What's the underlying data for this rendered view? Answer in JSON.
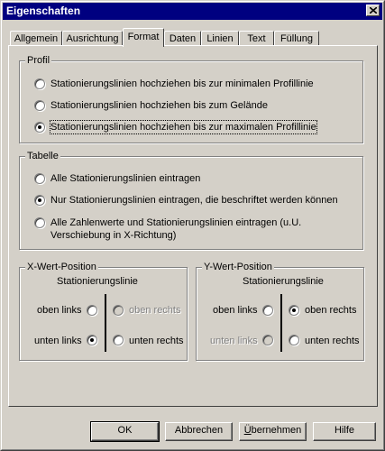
{
  "window": {
    "title": "Eigenschaften"
  },
  "tabs": [
    {
      "label": "Allgemein"
    },
    {
      "label": "Ausrichtung"
    },
    {
      "label": "Format"
    },
    {
      "label": "Daten"
    },
    {
      "label": "Linien"
    },
    {
      "label": "Text"
    },
    {
      "label": "Füllung"
    }
  ],
  "active_tab": "Format",
  "profil": {
    "label": "Profil",
    "options": [
      {
        "label": "Stationierungslinien hochziehen bis zur minimalen Profillinie",
        "checked": false
      },
      {
        "label": "Stationierungslinien hochziehen bis zum Gelände",
        "checked": false
      },
      {
        "label": "Stationierungslinien hochziehen bis zur maximalen Profillinie",
        "checked": true
      }
    ]
  },
  "tabelle": {
    "label": "Tabelle",
    "options": [
      {
        "label": "Alle Stationierungslinien eintragen",
        "checked": false
      },
      {
        "label": "Nur Stationierungslinien eintragen, die beschriftet werden können",
        "checked": true
      },
      {
        "label_line1": "Alle Zahlenwerte und Stationierungslinien eintragen (u.U.",
        "label_line2": "Verschiebung in X-Richtung)",
        "checked": false
      }
    ]
  },
  "x_pos": {
    "label": "X-Wert-Position",
    "subtitle": "Stationierungslinie",
    "oben_links": "oben links",
    "oben_rechts": "oben rechts",
    "unten_links": "unten links",
    "unten_rechts": "unten rechts"
  },
  "y_pos": {
    "label": "Y-Wert-Position",
    "subtitle": "Stationierungslinie",
    "oben_links": "oben links",
    "oben_rechts": "oben rechts",
    "unten_links": "unten links",
    "unten_rechts": "unten rechts"
  },
  "buttons": {
    "ok": "OK",
    "abbrechen": "Abbrechen",
    "uebernehmen_first": "Ü",
    "uebernehmen_rest": "bernehmen",
    "hilfe": "Hilfe"
  }
}
